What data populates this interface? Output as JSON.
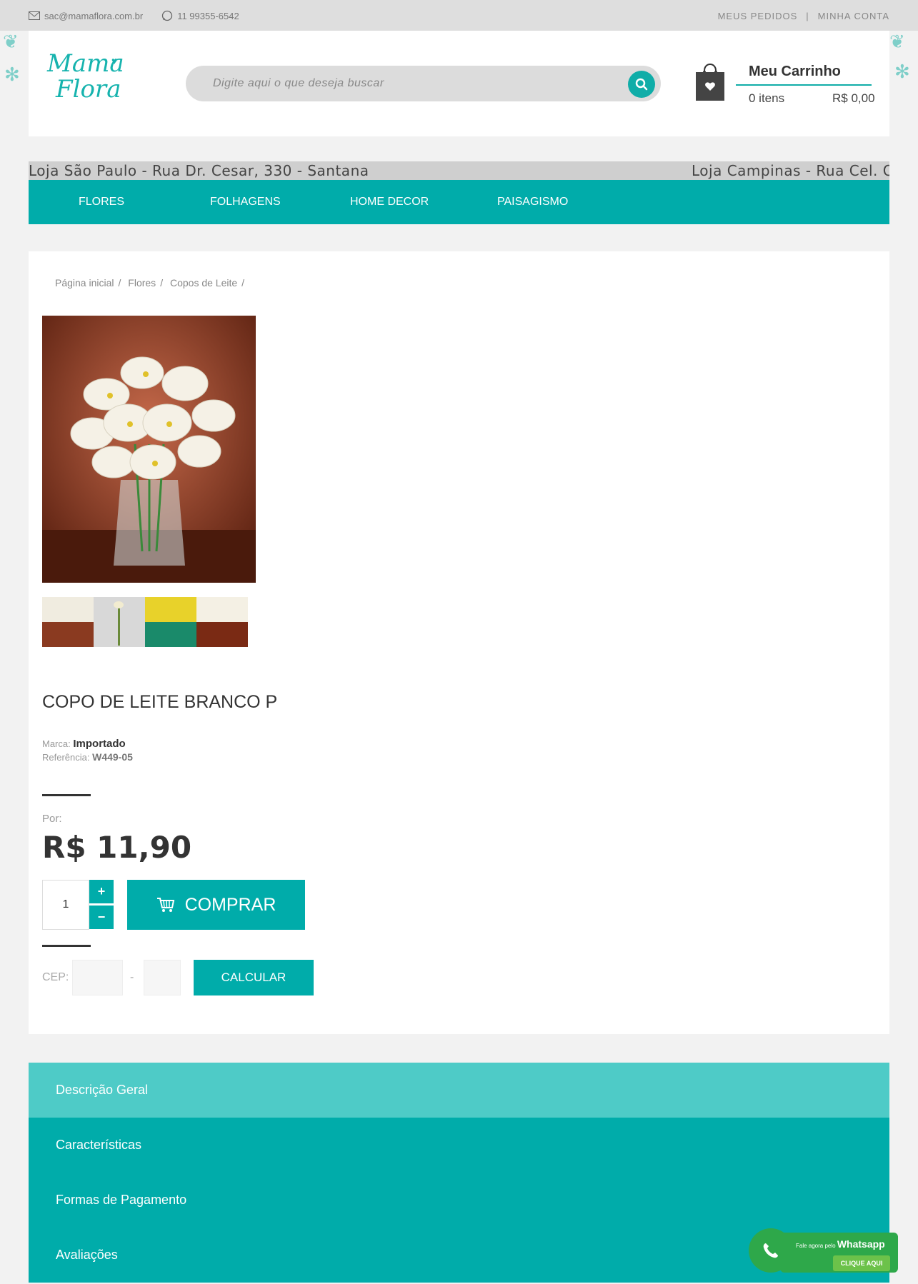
{
  "topbar": {
    "email": "sac@mamaflora.com.br",
    "phone": "11 99355-6542",
    "orders_link": "MEUS PEDIDOS",
    "separator": "|",
    "account_link": "MINHA CONTA"
  },
  "logo": {
    "line1": "Mama",
    "line2": "Flora"
  },
  "search": {
    "placeholder": "Digite aqui o que deseja buscar"
  },
  "cart": {
    "title": "Meu Carrinho",
    "items": "0 itens",
    "total": "R$ 0,00"
  },
  "marquee": {
    "store1": "Loja São Paulo - Rua Dr. Cesar, 330 - Santana",
    "store2": "Loja Campinas - Rua Cel. Qu"
  },
  "nav": {
    "items": [
      "FLORES",
      "FOLHAGENS",
      "HOME DECOR",
      "PAISAGISMO"
    ]
  },
  "breadcrumb": [
    "Página inicial",
    "Flores",
    "Copos de Leite"
  ],
  "product": {
    "title": "COPO DE LEITE BRANCO P",
    "brand_label": "Marca:",
    "brand": "Importado",
    "ref_label": "Referência:",
    "ref": "W449-05",
    "price_label": "Por:",
    "price": "R$ 11,90",
    "quantity": "1",
    "plus": "+",
    "minus": "−",
    "buy_label": "COMPRAR"
  },
  "shipping": {
    "cep_label": "CEP:",
    "dash": "-",
    "calc_label": "CALCULAR"
  },
  "tabs": [
    "Descrição Geral",
    "Características",
    "Formas de Pagamento",
    "Avaliações"
  ],
  "whatsapp": {
    "pre": "Fale agora pelo",
    "brand": "Whatsapp",
    "cta": "CLIQUE AQUI"
  },
  "colors": {
    "accent": "#00acaa",
    "accent_light": "#4ecbc7",
    "whatsapp": "#2ea84a"
  }
}
